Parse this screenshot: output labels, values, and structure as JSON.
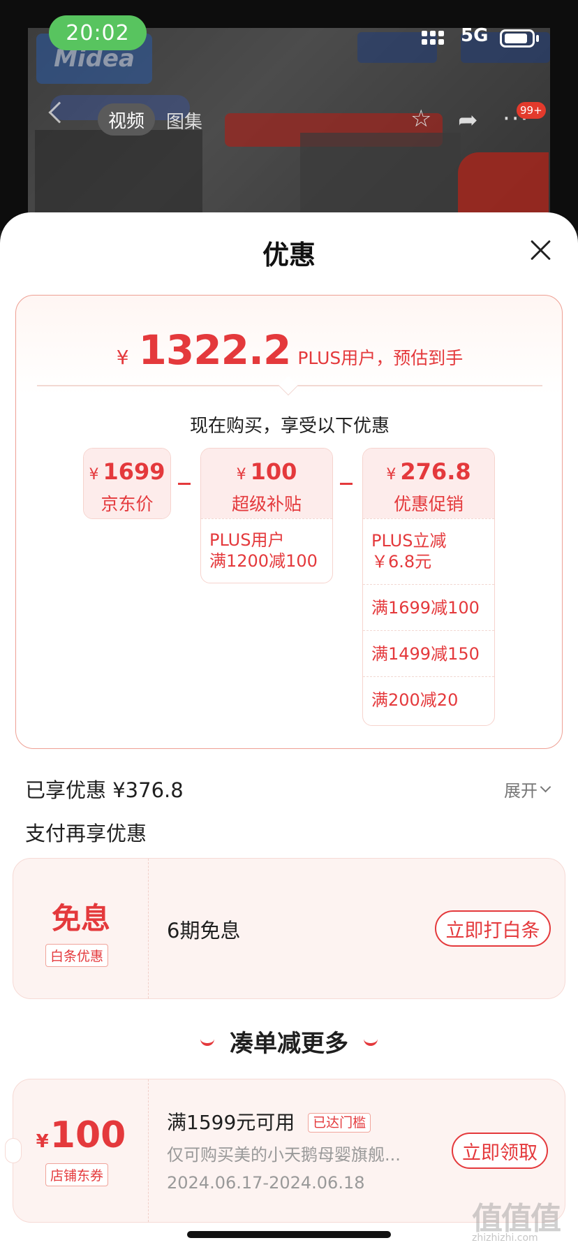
{
  "status_bar": {
    "time": "20:02",
    "network": "5G"
  },
  "product_nav": {
    "video_tab": "视频",
    "gallery_tab": "图集",
    "notification_count": "99+"
  },
  "sheet": {
    "title": "优惠"
  },
  "estimate": {
    "currency": "¥",
    "price": "1322.2",
    "label": "PLUS用户，预估到手"
  },
  "breakdown": {
    "heading": "现在购买，享受以下优惠",
    "items": [
      {
        "currency": "¥",
        "amount": "1699",
        "label": "京东价",
        "details": []
      },
      {
        "currency": "¥",
        "amount": "100",
        "label": "超级补贴",
        "details": [
          "PLUS用户\n满1200减100"
        ]
      },
      {
        "currency": "¥",
        "amount": "276.8",
        "label": "优惠促销",
        "details": [
          "PLUS立减\n￥6.8元",
          "满1699减100",
          "满1499减150",
          "满200减20"
        ]
      }
    ]
  },
  "enjoyed": {
    "text": "已享优惠 ¥376.8",
    "expand_label": "展开"
  },
  "payment": {
    "heading": "支付再享优惠",
    "title": "免息",
    "tag": "白条优惠",
    "text": "6期免息",
    "button": "立即打白条"
  },
  "more": {
    "title": "凑单减更多"
  },
  "coupon": {
    "currency": "¥",
    "amount": "100",
    "tag": "店铺东券",
    "condition": "满1599元可用",
    "condition_tag": "已达门槛",
    "description": "仅可购买美的小天鹅母婴旗舰...",
    "date_range": "2024.06.17-2024.06.18",
    "button": "立即领取"
  },
  "colors": {
    "accent": "#e4393c",
    "card_bg": "#fdf3f1",
    "border": "#ee9f93"
  }
}
